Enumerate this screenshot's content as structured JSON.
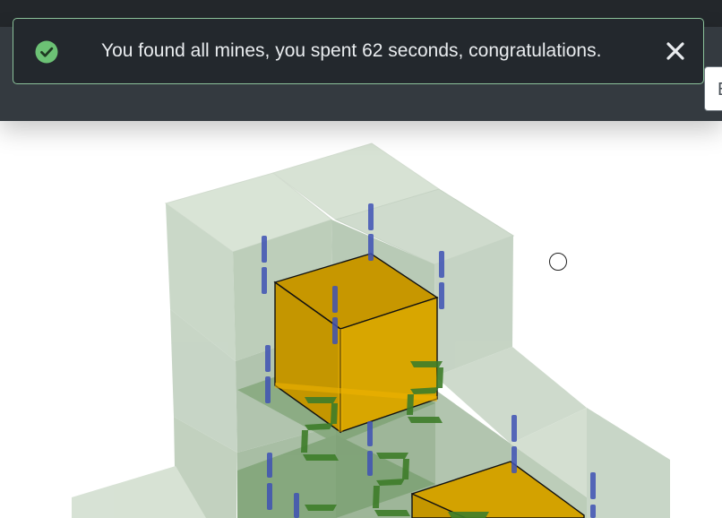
{
  "toast": {
    "message": "You found all mines, you spent 62 seconds, congratulations.",
    "icon": "check-circle-icon",
    "close_icon": "close-icon"
  },
  "header": {
    "right_control_text": "E"
  },
  "board": {
    "digits_visible": [
      "2",
      "2",
      "2"
    ],
    "colors": {
      "cell": "#c7d6c5",
      "mine_cube": "#d9a400",
      "digit_blue": "#3f52b5",
      "digit_green": "#3e7d2a",
      "toast_border": "#8bc19a",
      "toast_check": "#6cc275"
    }
  }
}
